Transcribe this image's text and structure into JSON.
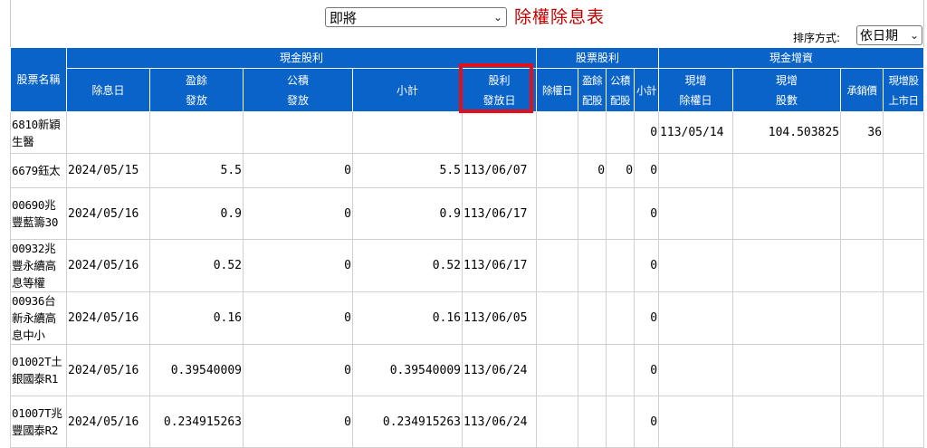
{
  "header": {
    "period_value": "即將",
    "title": "除權除息表",
    "sort_label": "排序方式:",
    "sort_value": "依日期"
  },
  "table": {
    "group_headers": {
      "cash_dividend": "現金股利",
      "stock_dividend": "股票股利",
      "cash_capital_increase": "現金增資"
    },
    "columns": {
      "stock_name": "股票名稱",
      "ex_div_date": "除息日",
      "earnings_l1": "盈餘",
      "earnings_l2": "發放",
      "capital_reserve_l1": "公積",
      "capital_reserve_l2": "發放",
      "subtotal": "小計",
      "pay_date_l1": "股利",
      "pay_date_l2": "發放日",
      "ex_rights_date": "除權日",
      "stock_earnings_l1": "盈餘",
      "stock_earnings_l2": "配股",
      "stock_reserve_l1": "公積",
      "stock_reserve_l2": "配股",
      "stock_subtotal": "小計",
      "ci_ex_rights_l1": "現增",
      "ci_ex_rights_l2": "除權日",
      "ci_shares_l1": "現增",
      "ci_shares_l2": "股數",
      "subscription_price": "承銷價",
      "ci_listing_l1": "現增股",
      "ci_listing_l2": "上市日"
    },
    "rows": [
      {
        "name": "6810新穎生醫",
        "ex_div_date": "",
        "earnings": "",
        "reserve": "",
        "subtotal": "",
        "pay_date": "",
        "ex_rights": "",
        "s_earn": "",
        "s_res": "",
        "s_sub": "0",
        "ci_date": "113/05/14",
        "ci_shares": "104.503825",
        "price": "36",
        "listing": ""
      },
      {
        "name": "6679鈺太",
        "ex_div_date": "2024/05/15",
        "earnings": "5.5",
        "reserve": "0",
        "subtotal": "5.5",
        "pay_date": "113/06/07",
        "ex_rights": "",
        "s_earn": "0",
        "s_res": "0",
        "s_sub": "0",
        "ci_date": "",
        "ci_shares": "",
        "price": "",
        "listing": ""
      },
      {
        "name": "00690兆豐藍籌30",
        "ex_div_date": "2024/05/16",
        "earnings": "0.9",
        "reserve": "0",
        "subtotal": "0.9",
        "pay_date": "113/06/17",
        "ex_rights": "",
        "s_earn": "",
        "s_res": "",
        "s_sub": "0",
        "ci_date": "",
        "ci_shares": "",
        "price": "",
        "listing": ""
      },
      {
        "name": "00932兆豐永續高息等權",
        "ex_div_date": "2024/05/16",
        "earnings": "0.52",
        "reserve": "0",
        "subtotal": "0.52",
        "pay_date": "113/06/17",
        "ex_rights": "",
        "s_earn": "",
        "s_res": "",
        "s_sub": "0",
        "ci_date": "",
        "ci_shares": "",
        "price": "",
        "listing": ""
      },
      {
        "name": "00936台新永續高息中小",
        "ex_div_date": "2024/05/16",
        "earnings": "0.16",
        "reserve": "0",
        "subtotal": "0.16",
        "pay_date": "113/06/05",
        "ex_rights": "",
        "s_earn": "",
        "s_res": "",
        "s_sub": "0",
        "ci_date": "",
        "ci_shares": "",
        "price": "",
        "listing": ""
      },
      {
        "name": "01002T土銀國泰R1",
        "ex_div_date": "2024/05/16",
        "earnings": "0.39540009",
        "reserve": "0",
        "subtotal": "0.39540009",
        "pay_date": "113/06/24",
        "ex_rights": "",
        "s_earn": "",
        "s_res": "",
        "s_sub": "0",
        "ci_date": "",
        "ci_shares": "",
        "price": "",
        "listing": ""
      },
      {
        "name": "01007T兆豐國泰R2",
        "ex_div_date": "2024/05/16",
        "earnings": "0.234915263",
        "reserve": "0",
        "subtotal": "0.234915263",
        "pay_date": "113/06/24",
        "ex_rights": "",
        "s_earn": "",
        "s_res": "",
        "s_sub": "0",
        "ci_date": "",
        "ci_shares": "",
        "price": "",
        "listing": ""
      }
    ]
  }
}
